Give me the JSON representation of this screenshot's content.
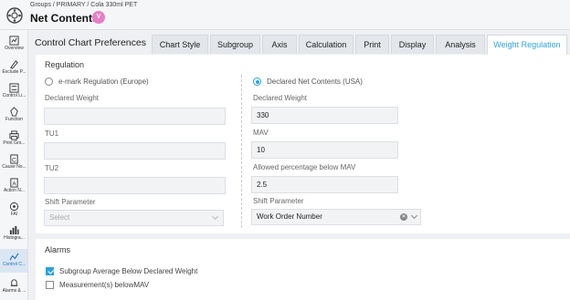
{
  "header": {
    "breadcrumb": "Groups / PRIMARY / Cola 330ml PET",
    "title": "Net Contents",
    "badge": "V"
  },
  "sidebar": {
    "items": [
      {
        "label": "Overview",
        "icon": "overview-icon"
      },
      {
        "label": "Exclude P...",
        "icon": "exclude-icon"
      },
      {
        "label": "Control Li...",
        "icon": "control-limits-icon"
      },
      {
        "label": "Function",
        "icon": "function-icon"
      },
      {
        "label": "Print Gro...",
        "icon": "print-icon"
      },
      {
        "label": "Cause No...",
        "icon": "cause-icon"
      },
      {
        "label": "Action N...",
        "icon": "action-icon"
      },
      {
        "label": "FAI",
        "icon": "fai-icon"
      },
      {
        "label": "Histogra...",
        "icon": "histogram-icon"
      },
      {
        "label": "Control C...",
        "icon": "control-chart-icon"
      },
      {
        "label": "Alarms & ...",
        "icon": "alarm-icon"
      }
    ]
  },
  "tabs": {
    "pane_title": "Control Chart Preferences",
    "items": [
      "Chart Style",
      "Subgroup",
      "Axis",
      "Calculation",
      "Print",
      "Display",
      "Analysis",
      "Weight Regulation"
    ],
    "active": "Weight Regulation"
  },
  "regulation": {
    "title": "Regulation",
    "emark": {
      "label": "e-mark Regulation (Europe)",
      "checked": false,
      "declared_weight_label": "Declared Weight",
      "declared_weight_value": "",
      "tu1_label": "TU1",
      "tu1_value": "",
      "tu2_label": "TU2",
      "tu2_value": "",
      "shift_label": "Shift Parameter",
      "shift_placeholder": "Select"
    },
    "usa": {
      "label": "Declared Net Contents (USA)",
      "checked": true,
      "declared_weight_label": "Declared Weight",
      "declared_weight_value": "330",
      "mav_label": "MAV",
      "mav_value": "10",
      "allowed_label": "Allowed percentage below MAV",
      "allowed_value": "2.5",
      "shift_label": "Shift Parameter",
      "shift_value": "Work Order Number"
    }
  },
  "alarms": {
    "title": "Alarms",
    "items": [
      {
        "label": "Subgroup Average Below Declared Weight",
        "checked": true
      },
      {
        "label": "Measurement(s) belowMAV",
        "checked": false
      }
    ]
  },
  "colors": {
    "accent": "#2aa3e0",
    "badge": "#e67fc6"
  }
}
